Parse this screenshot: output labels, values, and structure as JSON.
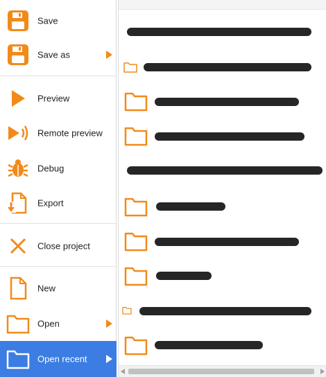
{
  "colors": {
    "accent": "#f28a1a",
    "selected_bg": "#3b7de2",
    "selected_text": "#ffffff"
  },
  "menu": {
    "items": [
      {
        "label": "Save",
        "icon": "floppy-disk-icon"
      },
      {
        "label": "Save as",
        "icon": "floppy-disk-icon",
        "submenu": true
      },
      {
        "label": "Preview",
        "icon": "play-icon"
      },
      {
        "label": "Remote preview",
        "icon": "remote-play-icon"
      },
      {
        "label": "Debug",
        "icon": "bug-icon"
      },
      {
        "label": "Export",
        "icon": "export-icon"
      },
      {
        "label": "Close project",
        "icon": "close-icon"
      },
      {
        "label": "New",
        "icon": "new-file-icon"
      },
      {
        "label": "Open",
        "icon": "folder-icon",
        "submenu": true
      },
      {
        "label": "Open recent",
        "icon": "folder-icon",
        "submenu": true,
        "selected": true
      }
    ]
  },
  "recent": {
    "entries": [
      {
        "icon": "none"
      },
      {
        "icon": "small-folder-icon"
      },
      {
        "icon": "folder-icon"
      },
      {
        "icon": "folder-icon"
      },
      {
        "icon": "none"
      },
      {
        "icon": "folder-icon"
      },
      {
        "icon": "folder-icon"
      },
      {
        "icon": "folder-icon"
      },
      {
        "icon": "small-folder-icon"
      },
      {
        "icon": "folder-icon"
      }
    ]
  }
}
